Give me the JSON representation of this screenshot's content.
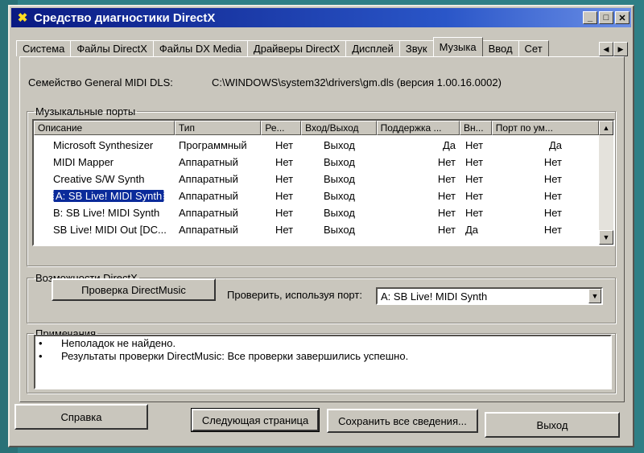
{
  "window": {
    "title": "Средство диагностики DirectX",
    "icon": "directx-x-icon",
    "controls": {
      "minimize": "_",
      "maximize": "□",
      "close": "✕"
    }
  },
  "tabs": [
    {
      "label": "Система"
    },
    {
      "label": "Файлы DirectX"
    },
    {
      "label": "Файлы DX Media"
    },
    {
      "label": "Драйверы DirectX"
    },
    {
      "label": "Дисплей"
    },
    {
      "label": "Звук"
    },
    {
      "label": "Музыка",
      "active": true
    },
    {
      "label": "Ввод"
    },
    {
      "label": "Сет"
    }
  ],
  "dls": {
    "label": "Семейство General MIDI DLS:",
    "value": "C:\\WINDOWS\\system32\\drivers\\gm.dls (версия 1.00.16.0002)"
  },
  "ports": {
    "group_label": "Музыкальные порты",
    "columns": [
      "Описание",
      "Тип",
      "Ре...",
      "Вход/Выход",
      "Поддержка ...",
      "Вн...",
      "Порт по ум..."
    ],
    "rows": [
      {
        "name": "Microsoft Synthesizer",
        "type": "Программный",
        "re": "Нет",
        "io": "Выход",
        "support": "Да",
        "vn": "Нет",
        "default": "Да"
      },
      {
        "name": "MIDI Mapper",
        "type": "Аппаратный",
        "re": "Нет",
        "io": "Выход",
        "support": "Нет",
        "vn": "Нет",
        "default": "Нет"
      },
      {
        "name": "Creative S/W Synth",
        "type": "Аппаратный",
        "re": "Нет",
        "io": "Выход",
        "support": "Нет",
        "vn": "Нет",
        "default": "Нет"
      },
      {
        "name": "A: SB Live! MIDI Synth",
        "type": "Аппаратный",
        "re": "Нет",
        "io": "Выход",
        "support": "Нет",
        "vn": "Нет",
        "default": "Нет",
        "selected": true
      },
      {
        "name": "B: SB Live! MIDI Synth",
        "type": "Аппаратный",
        "re": "Нет",
        "io": "Выход",
        "support": "Нет",
        "vn": "Нет",
        "default": "Нет"
      },
      {
        "name": "SB Live! MIDI Out [DC...",
        "type": "Аппаратный",
        "re": "Нет",
        "io": "Выход",
        "support": "Нет",
        "vn": "Да",
        "default": "Нет"
      }
    ]
  },
  "features": {
    "group_label": "Возможности DirectX",
    "test_button": "Проверка DirectMusic",
    "port_label": "Проверить, используя порт:",
    "port_selected": "A: SB Live! MIDI Synth"
  },
  "notes": {
    "group_label": "Примечания",
    "items": [
      "Неполадок не найдено.",
      "Результаты проверки DirectMusic: Все проверки завершились успешно."
    ]
  },
  "buttons": {
    "help": "Справка",
    "next": "Следующая страница",
    "save": "Сохранить все сведения...",
    "exit": "Выход"
  }
}
